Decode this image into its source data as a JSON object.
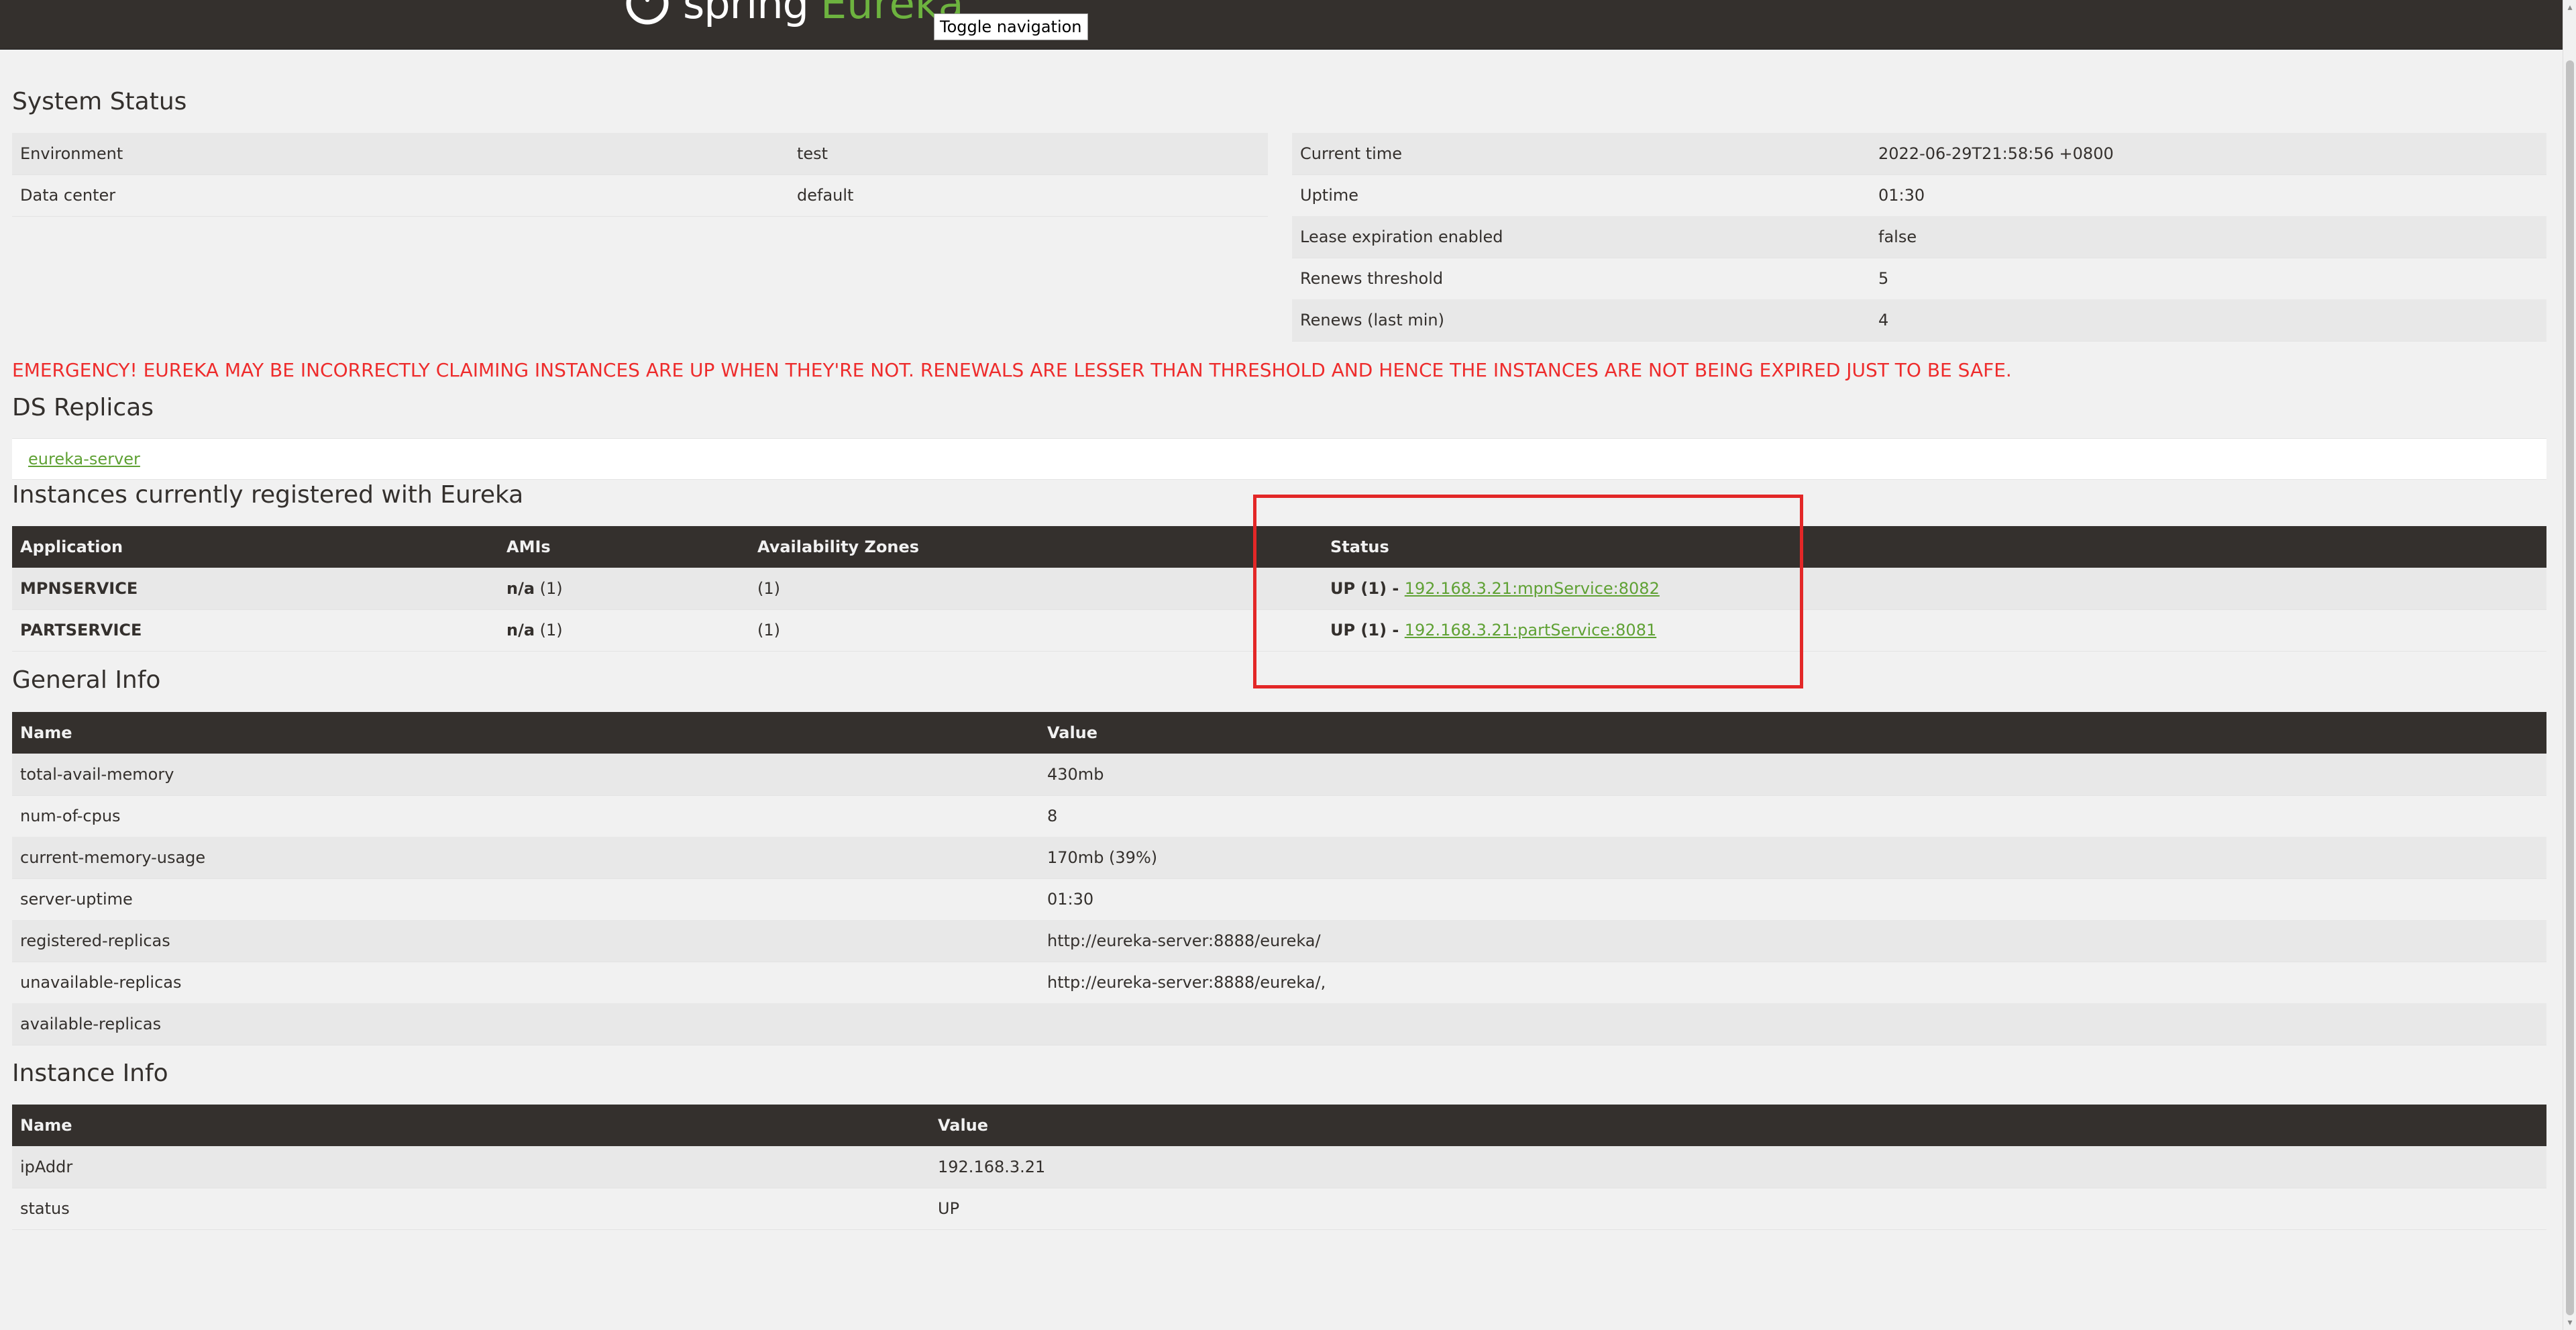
{
  "navbar": {
    "brand_spring": "spring",
    "brand_eureka": "Eureka",
    "toggle_label": "Toggle navigation"
  },
  "system_status": {
    "title": "System Status",
    "left": [
      {
        "label": "Environment",
        "value": "test"
      },
      {
        "label": "Data center",
        "value": "default"
      }
    ],
    "right": [
      {
        "label": "Current time",
        "value": "2022-06-29T21:58:56 +0800"
      },
      {
        "label": "Uptime",
        "value": "01:30"
      },
      {
        "label": "Lease expiration enabled",
        "value": "false"
      },
      {
        "label": "Renews threshold",
        "value": "5"
      },
      {
        "label": "Renews (last min)",
        "value": "4"
      }
    ]
  },
  "emergency_text": "EMERGENCY! EUREKA MAY BE INCORRECTLY CLAIMING INSTANCES ARE UP WHEN THEY'RE NOT. RENEWALS ARE LESSER THAN THRESHOLD AND HENCE THE INSTANCES ARE NOT BEING EXPIRED JUST TO BE SAFE.",
  "ds_replicas": {
    "title": "DS Replicas",
    "link": "eureka-server"
  },
  "instances": {
    "title": "Instances currently registered with Eureka",
    "headers": [
      "Application",
      "AMIs",
      "Availability Zones",
      "Status"
    ],
    "rows": [
      {
        "application": "MPNSERVICE",
        "amis_bold": "n/a",
        "amis_count": " (1)",
        "zones": "(1)",
        "status_prefix": "UP (1) - ",
        "status_link": "192.168.3.21:mpnService:8082"
      },
      {
        "application": "PARTSERVICE",
        "amis_bold": "n/a",
        "amis_count": " (1)",
        "zones": "(1)",
        "status_prefix": "UP (1) - ",
        "status_link": "192.168.3.21:partService:8081"
      }
    ],
    "highlight_color": "#e32727"
  },
  "general_info": {
    "title": "General Info",
    "headers": [
      "Name",
      "Value"
    ],
    "rows": [
      {
        "name": "total-avail-memory",
        "value": "430mb"
      },
      {
        "name": "num-of-cpus",
        "value": "8"
      },
      {
        "name": "current-memory-usage",
        "value": "170mb (39%)"
      },
      {
        "name": "server-uptime",
        "value": "01:30"
      },
      {
        "name": "registered-replicas",
        "value": "http://eureka-server:8888/eureka/"
      },
      {
        "name": "unavailable-replicas",
        "value": "http://eureka-server:8888/eureka/,"
      },
      {
        "name": "available-replicas",
        "value": ""
      }
    ]
  },
  "instance_info": {
    "title": "Instance Info",
    "headers": [
      "Name",
      "Value"
    ],
    "rows": [
      {
        "name": "ipAddr",
        "value": "192.168.3.21"
      },
      {
        "name": "status",
        "value": "UP"
      }
    ]
  },
  "colors": {
    "navbar_bg": "#34302d",
    "brand_green": "#6db33f",
    "link_green": "#5fa134",
    "emergency_red": "#ee2c2c"
  }
}
